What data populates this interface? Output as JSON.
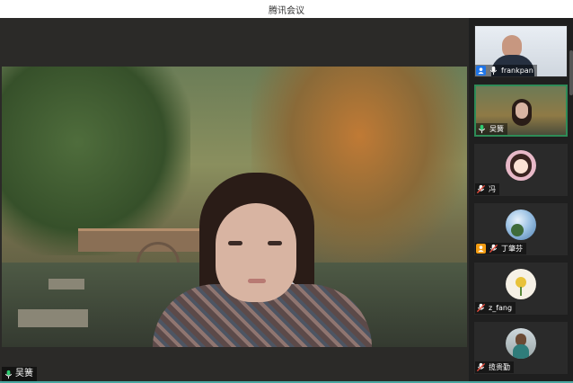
{
  "window": {
    "title": "腾讯会议"
  },
  "main_video": {
    "speaker_name": "吴簧"
  },
  "participants": [
    {
      "name": "frankpan",
      "badge": "blue",
      "mic": "on",
      "avatar_type": "video"
    },
    {
      "name": "吴簧",
      "badge": "none",
      "mic": "on-green",
      "avatar_type": "video",
      "active": true
    },
    {
      "name": "冯",
      "badge": "none",
      "mic": "muted",
      "avatar_type": "cartoon-girl"
    },
    {
      "name": "丁肇芬",
      "badge": "orange",
      "mic": "muted",
      "avatar_type": "sky-photo"
    },
    {
      "name": "z_fang",
      "badge": "none",
      "mic": "muted",
      "avatar_type": "flower"
    },
    {
      "name": "揽贵勤",
      "badge": "none",
      "mic": "muted",
      "avatar_type": "photo"
    }
  ],
  "colors": {
    "active_border": "#2e8b57",
    "badge_blue": "#1e74e8",
    "badge_orange": "#f39c12",
    "accent_line": "#49a6a0"
  },
  "icons": [
    "user-icon",
    "microphone-icon",
    "microphone-muted-icon"
  ]
}
